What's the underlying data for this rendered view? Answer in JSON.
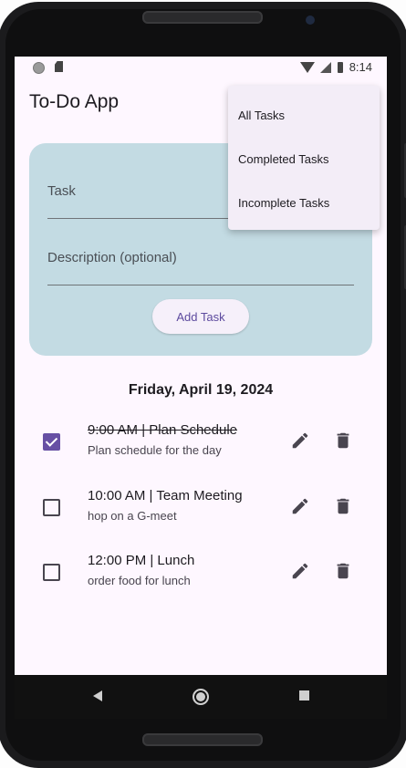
{
  "status_bar": {
    "time": "8:14"
  },
  "app": {
    "title": "To-Do App"
  },
  "form": {
    "task_placeholder": "Task",
    "description_placeholder": "Description (optional)",
    "add_button": "Add Task"
  },
  "date_heading": "Friday, April 19, 2024",
  "tasks": [
    {
      "title": "9:00 AM | Plan Schedule",
      "description": "Plan schedule for the day",
      "completed": true
    },
    {
      "title": "10:00 AM | Team Meeting",
      "description": "hop on a G-meet",
      "completed": false
    },
    {
      "title": "12:00 PM | Lunch",
      "description": "order food for lunch",
      "completed": false
    }
  ],
  "filter_menu": {
    "items": [
      "All Tasks",
      "Completed Tasks",
      "Incomplete Tasks"
    ]
  },
  "colors": {
    "accent": "#6750a4",
    "form_background": "#c3dbe3",
    "screen_background": "#fef7ff",
    "icon": "#49454f"
  },
  "icons": {
    "edit": "pencil-icon",
    "delete": "trash-icon"
  }
}
